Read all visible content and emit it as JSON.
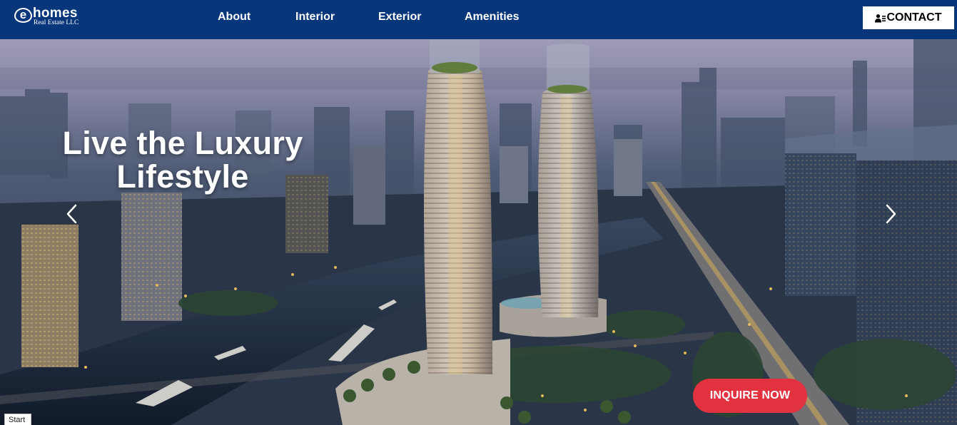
{
  "logo": {
    "mark": "e",
    "name": "homes",
    "subtitle": "Real Estate LLC"
  },
  "nav": {
    "links": [
      {
        "label": "About"
      },
      {
        "label": "Interior"
      },
      {
        "label": "Exterior"
      },
      {
        "label": "Amenities"
      }
    ],
    "contact": {
      "label": "CONTACT",
      "icon": "contact-card-icon"
    }
  },
  "hero": {
    "headline_line1": "Live the Luxury",
    "headline_line2": "Lifestyle",
    "prev_icon": "chevron-left-icon",
    "next_icon": "chevron-right-icon",
    "cta_label": "INQUIRE NOW",
    "cta_color": "#e2323f"
  },
  "status": {
    "start_label": "Start"
  },
  "colors": {
    "navbar": "#07367a",
    "contact_bg": "#ffffff",
    "headline": "#ffffff"
  }
}
